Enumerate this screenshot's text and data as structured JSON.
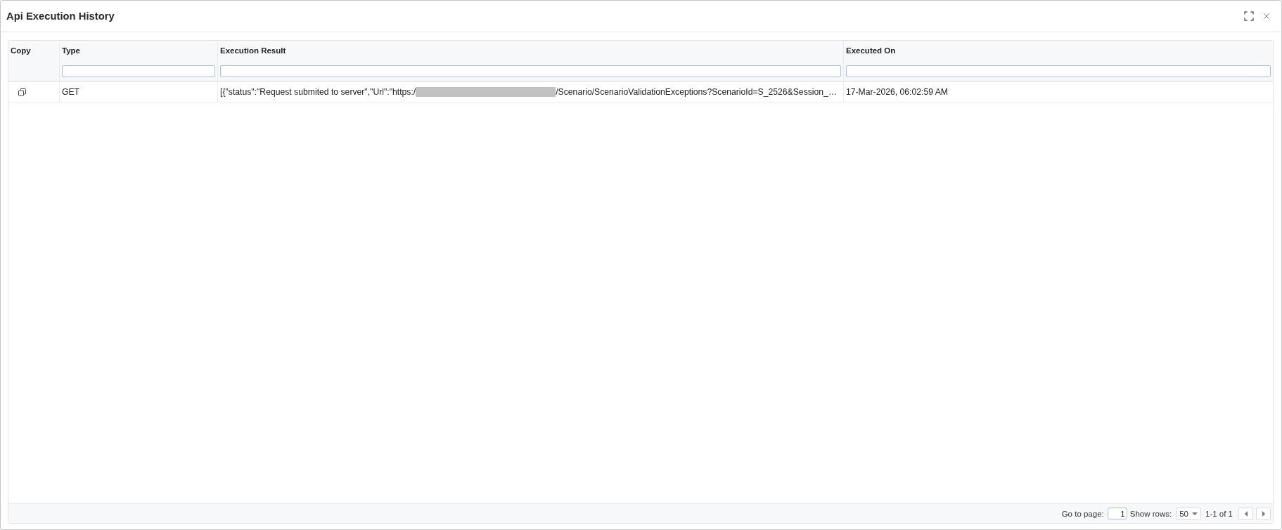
{
  "window": {
    "title": "Api Execution History"
  },
  "table": {
    "columns": [
      {
        "label": "Copy",
        "filterable": false
      },
      {
        "label": "Type",
        "filterable": true
      },
      {
        "label": "Execution Result",
        "filterable": true
      },
      {
        "label": "Executed On",
        "filterable": true
      }
    ],
    "rows": [
      {
        "type": "GET",
        "execution_result": [
          {
            "kind": "text",
            "text": "[{\"status\":\"Request submited to server\",\"Url\":\"https:/"
          },
          {
            "kind": "redacted"
          },
          {
            "kind": "text",
            "text": "/Scenario/ScenarioValidationExceptions?ScenarioId=S_2526&Session_…"
          }
        ],
        "executed_on": "17-Mar-2026, 06:02:59 AM"
      }
    ]
  },
  "pagination": {
    "go_to_page_label": "Go to page:",
    "page": "1",
    "show_rows_label": "Show rows:",
    "rows_per_page": "50",
    "range": "1-1 of 1"
  }
}
